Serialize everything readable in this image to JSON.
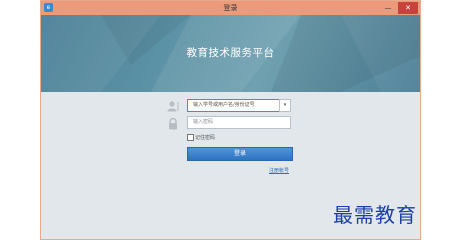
{
  "window": {
    "title": "登录",
    "app_icon": "e",
    "minimize_icon": "—",
    "close_icon": "✕"
  },
  "banner": {
    "title": "教育技术服务平台"
  },
  "login": {
    "username_value": "输入学号或用户名/身份证号",
    "combo_arrow": "▾",
    "password_placeholder": "输入密码",
    "remember_label": "记住密码",
    "login_button": "登录",
    "register_link": "注册帐号"
  },
  "watermark": {
    "text": "最需教育"
  }
}
